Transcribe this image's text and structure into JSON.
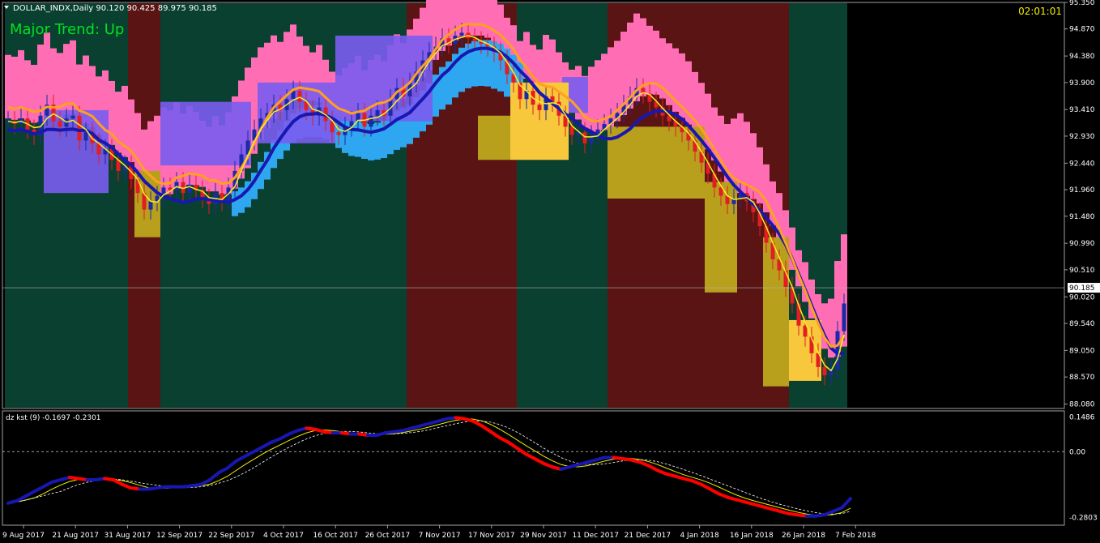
{
  "window": {
    "symbol_line": "DOLLAR_INDX,Daily  90.120 90.425 89.975 90.185",
    "clock": "02:01:01",
    "trend_label": "Major Trend: Up",
    "indicator_line": "dz kst (9) -0.1697 -0.2301",
    "current_price": "90.185"
  },
  "colors": {
    "background": "#000000",
    "zone_green": "#0a4030",
    "zone_red": "#5a1414",
    "band_pink": "#ff6eb4",
    "band_blue": "#2ea6f0",
    "band_purple": "#7a5cf0",
    "band_olive": "#b8a01c",
    "band_yellow": "#f8c83c",
    "bull_candle": "#1a2aa8",
    "bear_candle": "#e41c24",
    "bull_candle_alt": "#8cf0ff",
    "bear_candle_alt": "#f8f000",
    "ma_slow": "#1818b0",
    "ma_fast": "#ffa020",
    "ma_signal": "#f8f020",
    "trend_text": "#00e020",
    "clock_text": "#f8f000",
    "kst_up": "#1818b0",
    "kst_down": "#ff0000"
  },
  "chart_data": [
    {
      "type": "candlestick",
      "title": "",
      "ylim": [
        88.0,
        95.35
      ],
      "y_ticks": [
        "95.350",
        "94.870",
        "94.380",
        "93.900",
        "93.410",
        "92.930",
        "92.440",
        "91.960",
        "91.480",
        "90.990",
        "90.510",
        "90.020",
        "89.540",
        "89.050",
        "88.570",
        "88.080"
      ],
      "x_ticks": [
        "9 Aug 2017",
        "21 Aug 2017",
        "31 Aug 2017",
        "12 Sep 2017",
        "22 Sep 2017",
        "4 Oct 2017",
        "16 Oct 2017",
        "26 Oct 2017",
        "7 Nov 2017",
        "17 Nov 2017",
        "29 Nov 2017",
        "11 Dec 2017",
        "21 Dec 2017",
        "4 Jan 2018",
        "16 Jan 2018",
        "26 Jan 2018",
        "7 Feb 2018"
      ],
      "last_price": 90.185,
      "zones": [
        {
          "from": 0,
          "to": 19,
          "kind": "green"
        },
        {
          "from": 19,
          "to": 24,
          "kind": "red"
        },
        {
          "from": 24,
          "to": 62,
          "kind": "green"
        },
        {
          "from": 62,
          "to": 79,
          "kind": "red"
        },
        {
          "from": 79,
          "to": 93,
          "kind": "green"
        },
        {
          "from": 93,
          "to": 121,
          "kind": "red"
        },
        {
          "from": 121,
          "to": 130,
          "kind": "green"
        }
      ],
      "close": [
        93.2,
        93.15,
        93.25,
        93.05,
        92.95,
        93.3,
        93.5,
        93.2,
        93.1,
        93.25,
        93.3,
        92.85,
        93.0,
        92.8,
        92.6,
        92.7,
        92.5,
        92.3,
        92.4,
        92.15,
        91.9,
        91.6,
        91.75,
        91.85,
        92.0,
        91.95,
        92.1,
        91.9,
        92.05,
        91.95,
        91.8,
        91.7,
        91.9,
        91.75,
        92.0,
        92.3,
        92.6,
        92.85,
        93.05,
        93.25,
        93.35,
        93.5,
        93.4,
        93.6,
        93.75,
        93.55,
        93.4,
        93.3,
        93.45,
        93.2,
        93.0,
        92.95,
        93.1,
        93.2,
        93.35,
        93.1,
        93.3,
        93.4,
        93.3,
        93.6,
        93.8,
        93.65,
        93.9,
        94.1,
        94.3,
        94.45,
        94.55,
        94.7,
        94.6,
        94.75,
        94.8,
        94.7,
        94.65,
        94.6,
        94.55,
        94.45,
        94.3,
        94.05,
        93.9,
        93.6,
        93.75,
        93.5,
        93.4,
        93.65,
        93.55,
        93.3,
        93.1,
        92.95,
        93.0,
        92.8,
        92.95,
        93.05,
        93.15,
        93.25,
        93.35,
        93.5,
        93.65,
        93.8,
        93.7,
        93.55,
        93.45,
        93.3,
        93.2,
        93.1,
        93.0,
        92.85,
        92.65,
        92.45,
        92.25,
        92.0,
        91.85,
        91.7,
        91.8,
        91.9,
        91.75,
        91.55,
        91.3,
        91.0,
        90.7,
        90.5,
        90.2,
        89.9,
        89.5,
        89.3,
        89.0,
        88.75,
        88.6,
        88.7,
        89.4,
        89.9
      ],
      "kst": {
        "ylim": [
          -0.3,
          0.16
        ],
        "y_ticks": [
          "0.1486",
          "0.00",
          "-0.2803"
        ],
        "values": [
          -0.22,
          -0.21,
          -0.19,
          -0.17,
          -0.15,
          -0.13,
          -0.12,
          -0.11,
          -0.115,
          -0.12,
          -0.12,
          -0.115,
          -0.12,
          -0.14,
          -0.155,
          -0.16,
          -0.16,
          -0.155,
          -0.15,
          -0.15,
          -0.15,
          -0.145,
          -0.14,
          -0.12,
          -0.09,
          -0.07,
          -0.04,
          -0.02,
          0.0,
          0.02,
          0.04,
          0.055,
          0.075,
          0.09,
          0.1,
          0.095,
          0.085,
          0.08,
          0.08,
          0.075,
          0.075,
          0.07,
          0.07,
          0.08,
          0.085,
          0.09,
          0.1,
          0.11,
          0.12,
          0.13,
          0.14,
          0.145,
          0.14,
          0.13,
          0.11,
          0.085,
          0.06,
          0.04,
          0.015,
          -0.01,
          -0.03,
          -0.05,
          -0.065,
          -0.075,
          -0.065,
          -0.055,
          -0.045,
          -0.035,
          -0.025,
          -0.025,
          -0.03,
          -0.035,
          -0.045,
          -0.06,
          -0.08,
          -0.095,
          -0.105,
          -0.115,
          -0.125,
          -0.14,
          -0.16,
          -0.18,
          -0.195,
          -0.205,
          -0.215,
          -0.225,
          -0.235,
          -0.245,
          -0.255,
          -0.265,
          -0.27,
          -0.275,
          -0.275,
          -0.27,
          -0.255,
          -0.24,
          -0.2
        ]
      }
    }
  ]
}
